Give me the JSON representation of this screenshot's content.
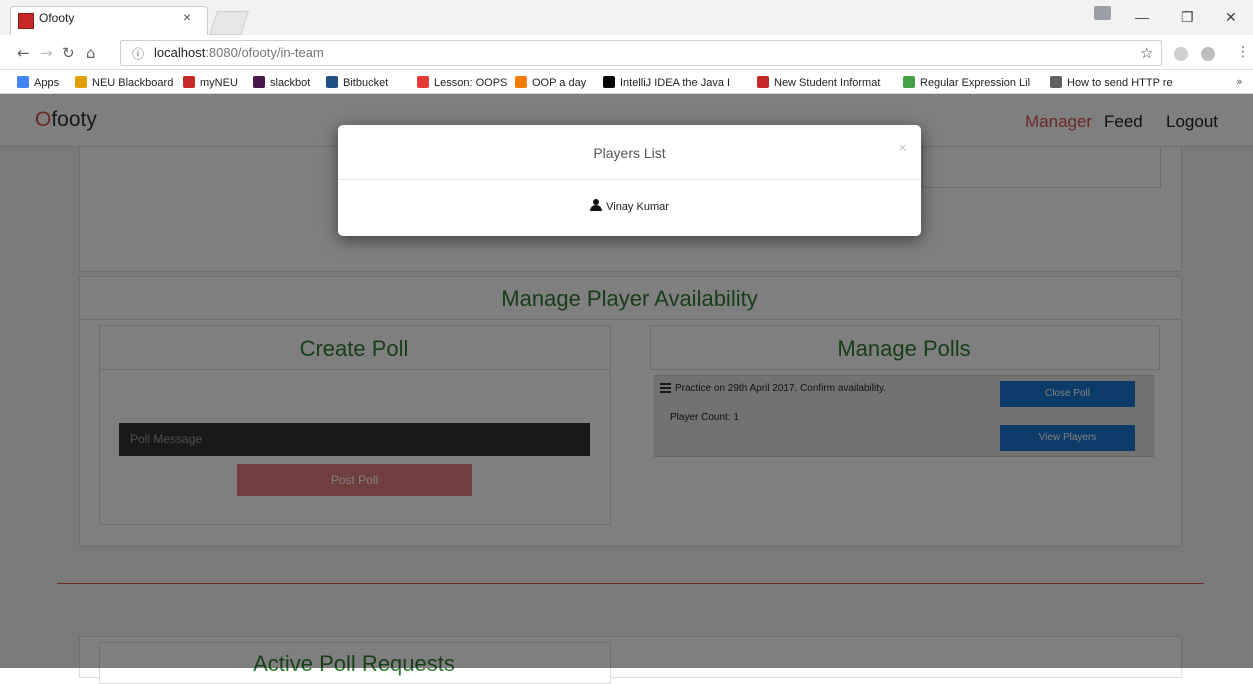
{
  "browser": {
    "tab_title": "Ofooty",
    "tab_close": "×",
    "url_host": "localhost",
    "url_rest": ":8080/ofooty/in-team",
    "window_minimize": "—",
    "window_restore": "❐",
    "window_close": "✕",
    "bookmarks": [
      {
        "label": "Apps",
        "color": "#4285f4"
      },
      {
        "label": "NEU Blackboard",
        "color": "#e0a100"
      },
      {
        "label": "myNEU",
        "color": "#c62828"
      },
      {
        "label": "slackbot",
        "color": "#4a154b"
      },
      {
        "label": "Bitbucket",
        "color": "#205081"
      },
      {
        "label": "Lesson: OOPS",
        "color": "#e53935"
      },
      {
        "label": "OOP a day",
        "color": "#f57c00"
      },
      {
        "label": "IntelliJ IDEA the Java I",
        "color": "#000000"
      },
      {
        "label": "New Student Informat",
        "color": "#c62828"
      },
      {
        "label": "Regular Expression Lil",
        "color": "#43a047"
      },
      {
        "label": "How to send HTTP re",
        "color": "#616161"
      }
    ],
    "bookmarks_more": "»"
  },
  "navbar": {
    "brand_first": "O",
    "brand_rest": "footy",
    "links": [
      "Manager",
      "Feed",
      "Logout"
    ],
    "active_color": "#d9534f"
  },
  "main": {
    "section_title": "Manage Player Availability",
    "create_poll": {
      "title": "Create Poll",
      "input_placeholder": "Poll Message",
      "post_button": "Post Poll"
    },
    "manage_polls": {
      "title": "Manage Polls",
      "poll_text": "Practice on 29th April 2017. Confirm availability.",
      "player_count": "Player Count: 1",
      "close_button": "Close Poll",
      "view_button": "View Players"
    },
    "active_requests_title": "Active Poll Requests"
  },
  "modal": {
    "title": "Players List",
    "close": "×",
    "players": [
      "Vinay Kumar"
    ]
  },
  "colors": {
    "accent_green": "#2f7d32",
    "accent_red": "#d9534f",
    "button_blue": "#1976d2"
  }
}
